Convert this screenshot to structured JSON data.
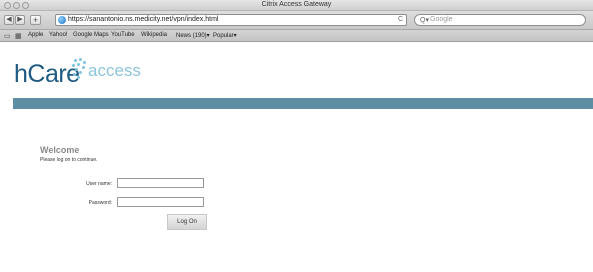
{
  "window": {
    "title": "Citrix Access Gateway"
  },
  "toolbar": {
    "back_icon": "◀",
    "forward_icon": "▶",
    "add_icon": "+",
    "url": "https://sanantonio.ns.medicity.net/vpn/index.html",
    "reload_icon": "C",
    "search_placeholder": "Google",
    "search_icon": "Q▾"
  },
  "bookmarks": {
    "items": [
      "Apple",
      "Yahoo!",
      "Google Maps",
      "YouTube",
      "Wikipedia",
      "News (190)▾",
      "Popular▾"
    ]
  },
  "brand": {
    "logo_main": "hCare",
    "logo_sub": "access",
    "banner_color": "#5e8ea4",
    "logo_color": "#1e5a82",
    "logo_accent": "#8cc6dc"
  },
  "login": {
    "heading": "Welcome",
    "subheading": "Please log on to continue.",
    "username_label": "User name:",
    "username_value": "",
    "password_label": "Password:",
    "password_value": "",
    "submit_label": "Log On"
  }
}
